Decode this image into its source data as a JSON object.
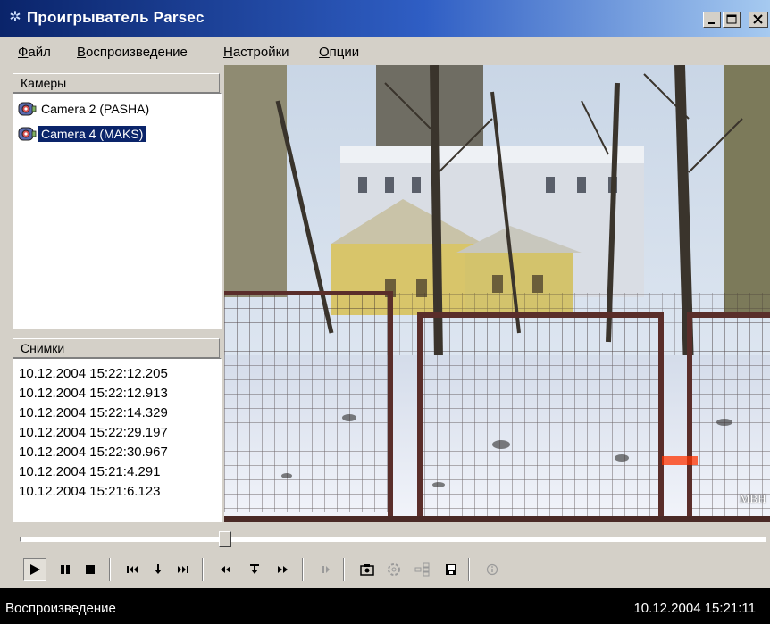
{
  "window": {
    "title": "Проигрыватель Parsec",
    "app_icon": "parsec-icon",
    "buttons": [
      "minimize-icon",
      "maximize-icon",
      "close-icon"
    ]
  },
  "menu": {
    "items": [
      {
        "label": "Файл"
      },
      {
        "label": "Воспроизведение"
      },
      {
        "label": "Настройки"
      },
      {
        "label": "Опции"
      }
    ]
  },
  "cameras": {
    "header": "Камеры",
    "items": [
      {
        "label": "Camera 2 (PASHA)",
        "selected": false
      },
      {
        "label": "Camera 4 (MAKS)",
        "selected": true
      }
    ]
  },
  "snapshots": {
    "header": "Снимки",
    "items": [
      "10.12.2004 15:22:12.205",
      "10.12.2004 15:22:12.913",
      "10.12.2004 15:22:14.329",
      "10.12.2004 15:22:29.197",
      "10.12.2004 15:22:30.967",
      "10.12.2004 15:21:4.291",
      "10.12.2004 15:21:6.123"
    ]
  },
  "video": {
    "overlay_text": "МВН",
    "overlay_text_color": "#ffffff",
    "timestamp_text_color": "#ff3300"
  },
  "playback": {
    "position_fraction": 0.28,
    "buttons": [
      "play-icon",
      "pause-icon",
      "stop-icon",
      "skip-to-start-icon",
      "step-down-icon",
      "skip-to-end-icon",
      "rewind-icon",
      "frame-step-icon",
      "fast-forward-icon",
      "step-forward-icon",
      "snapshot-icon",
      "settings-gear-icon",
      "layout-icon",
      "save-icon",
      "info-icon"
    ]
  },
  "status": {
    "left": "Воспроизведение",
    "right": "10.12.2004 15:21:11"
  },
  "colors": {
    "titlebar_start": "#0a246a",
    "titlebar_end": "#a6caf0",
    "selection": "#0a246a",
    "face": "#d4d0c8",
    "statusbar": "#000000"
  }
}
